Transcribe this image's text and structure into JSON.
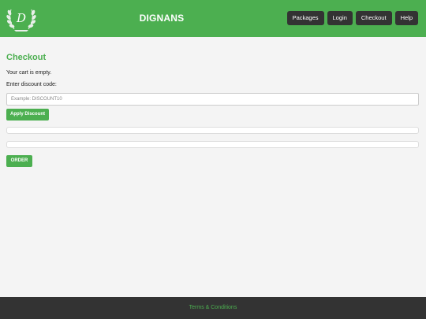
{
  "header": {
    "brand": "DIGNANS",
    "logo_letter": "D",
    "nav": [
      "Packages",
      "Login",
      "Checkout",
      "Help"
    ]
  },
  "checkout": {
    "title": "Checkout",
    "empty_message": "Your cart is empty.",
    "discount_label": "Enter discount code:",
    "discount_placeholder": "Example: DISCOUNT10",
    "apply_label": "Apply Discount",
    "order_label": "ORDER"
  },
  "footer": {
    "link": "Terms & Conditions"
  },
  "colors": {
    "accent": "#4caf50",
    "dark": "#333333",
    "background": "#f4f4f4"
  }
}
